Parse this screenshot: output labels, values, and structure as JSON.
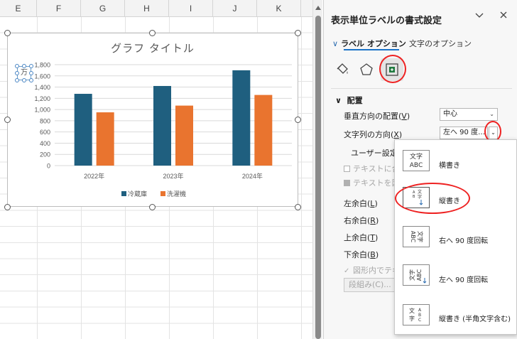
{
  "sheet": {
    "columns": [
      "E",
      "F",
      "G",
      "H",
      "I",
      "J",
      "K"
    ]
  },
  "chart": {
    "unit_label": "万"
  },
  "chart_data": {
    "type": "bar",
    "title": "グラフ タイトル",
    "categories": [
      "2022年",
      "2023年",
      "2024年"
    ],
    "series": [
      {
        "name": "冷蔵庫",
        "values": [
          1280,
          1420,
          1700
        ],
        "color": "#1f5f7f"
      },
      {
        "name": "洗濯機",
        "values": [
          950,
          1070,
          1260
        ],
        "color": "#e9742f"
      }
    ],
    "ylim": [
      0,
      1800
    ],
    "yticks": [
      "0",
      "200",
      "400",
      "600",
      "800",
      "1,000",
      "1,200",
      "1,400",
      "1,600",
      "1,800"
    ],
    "legend_position": "bottom",
    "grid": true
  },
  "pane": {
    "title": "表示単位ラベルの書式設定",
    "tab_label_options": "ラベル オプション",
    "tab_text_options": "文字のオプション",
    "section_alignment": "配置",
    "vertical_alignment_label": "垂直方向の配置(",
    "vertical_alignment_key": "V",
    "vertical_alignment_value": "中心",
    "text_direction_label": "文字列の方向(",
    "text_direction_key": "X",
    "text_direction_value": "左へ 90 度…",
    "custom_angle_label": "ユーザー設定の",
    "wrap_text_label": "テキストに合わ",
    "wrap_shape_label": "テキストを図形",
    "left_margin_label": "左余白(",
    "left_margin_key": "L",
    "right_margin_label": "右余白(",
    "right_margin_key": "R",
    "top_margin_label": "上余白(",
    "top_margin_key": "T",
    "bottom_margin_label": "下余白(",
    "bottom_margin_key": "B",
    "wrap_in_shape_label": "図形内でテキ",
    "columns_button": "段組み(C)..."
  },
  "dropdown": {
    "items": [
      {
        "label": "横書き",
        "icon_text": "文字ABC"
      },
      {
        "label": "縦書き",
        "icon_text": "縦書"
      },
      {
        "label": "右へ 90 度回転",
        "icon_text": "右90"
      },
      {
        "label": "左へ 90 度回転",
        "icon_text": "左90"
      },
      {
        "label": "縦書き (半角文字含む)",
        "icon_text": "文字ABC"
      }
    ]
  }
}
